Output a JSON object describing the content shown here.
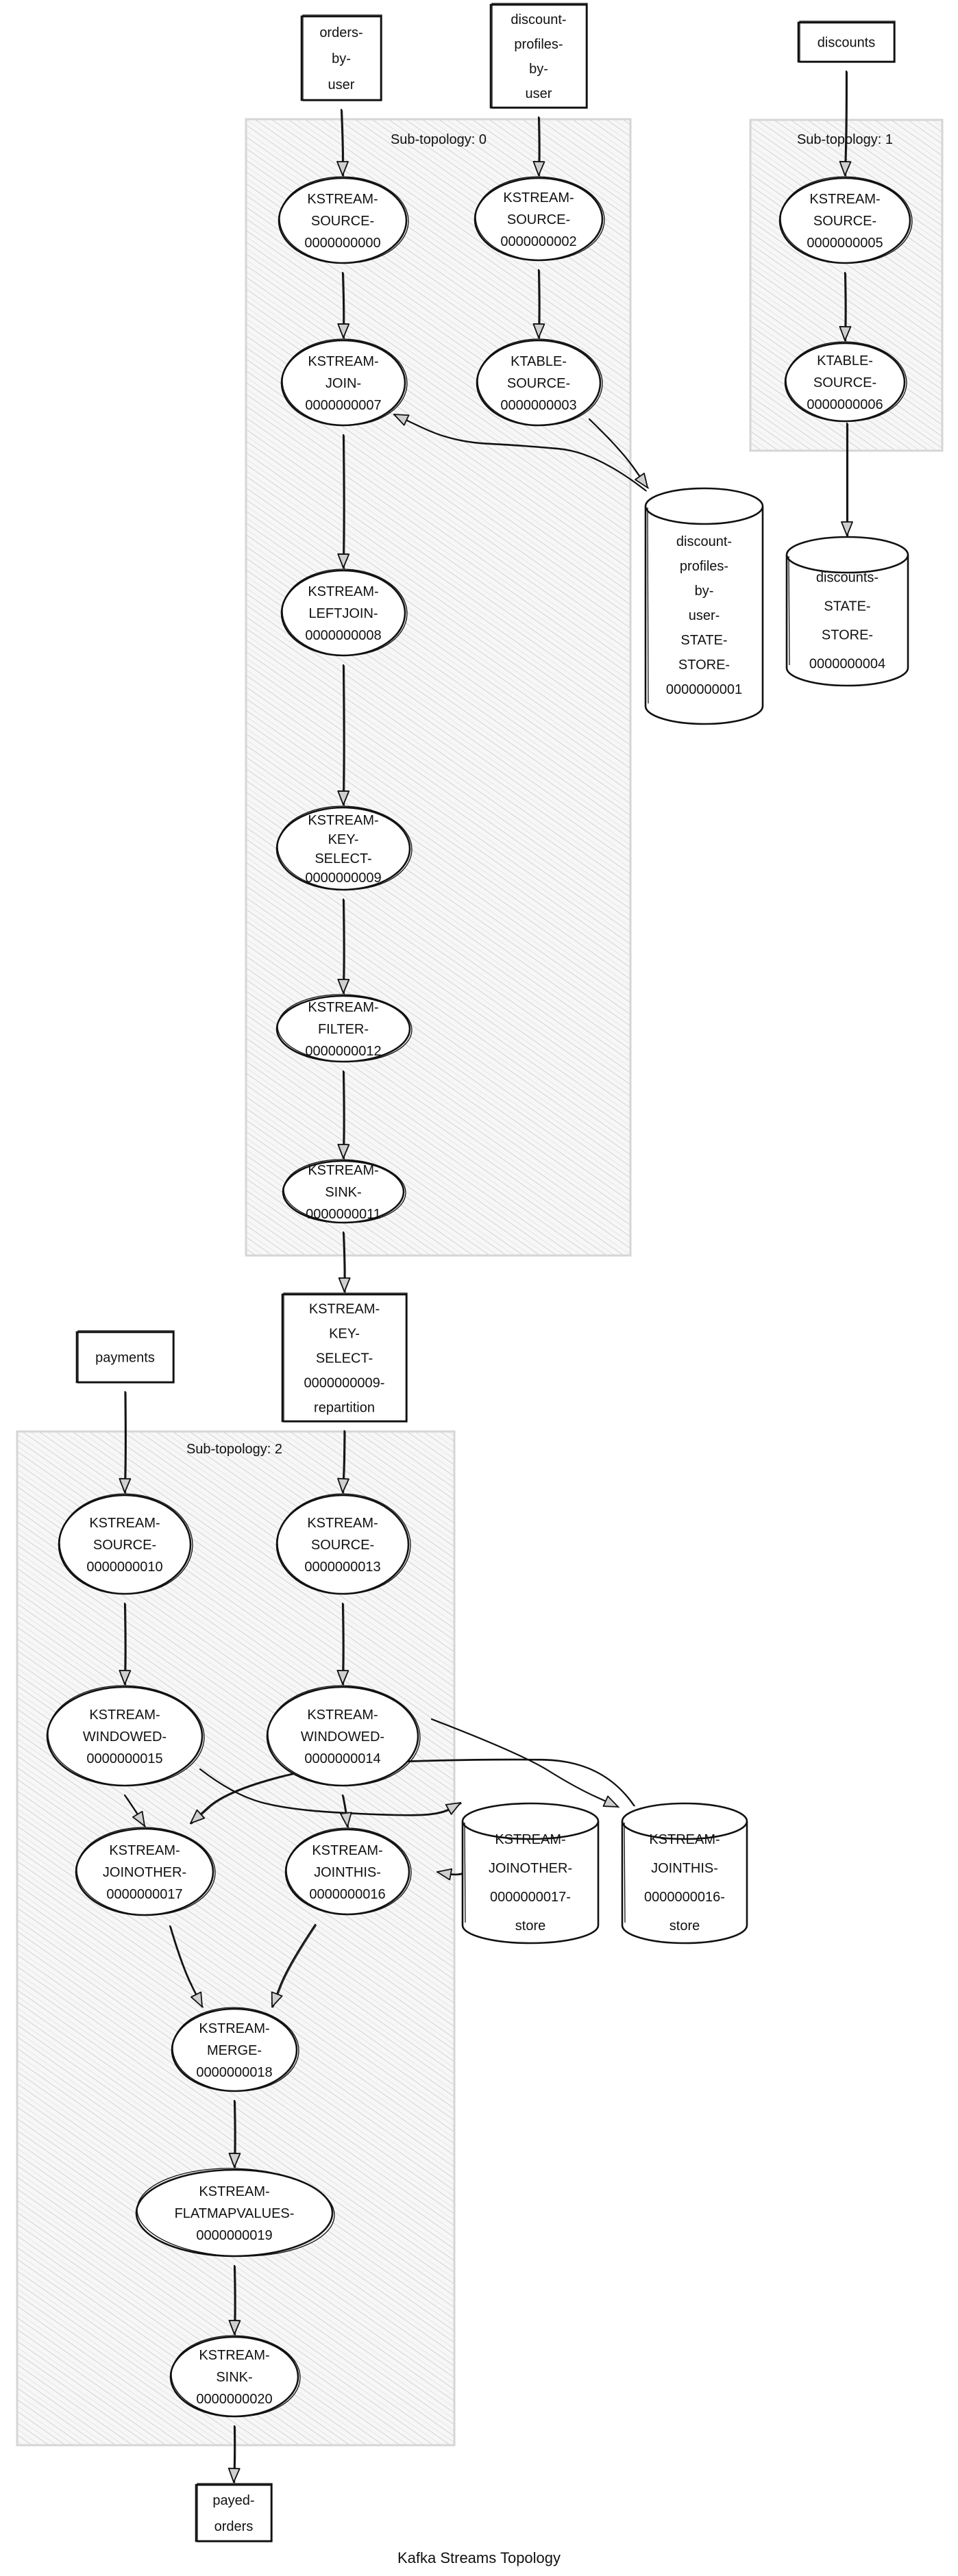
{
  "title": "Kafka Streams Topology",
  "clusters": [
    {
      "id": "sub0",
      "label": "Sub-topology: 0"
    },
    {
      "id": "sub1",
      "label": "Sub-topology: 1"
    },
    {
      "id": "sub2",
      "label": "Sub-topology: 2"
    }
  ],
  "topics": [
    {
      "id": "orders-by-user",
      "lines": [
        "orders-",
        "by-",
        "user"
      ]
    },
    {
      "id": "discount-profiles-by-user",
      "lines": [
        "discount-",
        "profiles-",
        "by-",
        "user"
      ]
    },
    {
      "id": "discounts",
      "lines": [
        "discounts"
      ]
    },
    {
      "id": "repartition",
      "lines": [
        "KSTREAM-",
        "KEY-",
        "SELECT-",
        "0000000009-",
        "repartition"
      ]
    },
    {
      "id": "payments",
      "lines": [
        "payments"
      ]
    },
    {
      "id": "payed-orders",
      "lines": [
        "payed-",
        "orders"
      ]
    }
  ],
  "processors": [
    {
      "id": "src0",
      "cluster": "sub0",
      "lines": [
        "KSTREAM-",
        "SOURCE-",
        "0000000000"
      ]
    },
    {
      "id": "src2",
      "cluster": "sub0",
      "lines": [
        "KSTREAM-",
        "SOURCE-",
        "0000000002"
      ]
    },
    {
      "id": "join7",
      "cluster": "sub0",
      "lines": [
        "KSTREAM-",
        "JOIN-",
        "0000000007"
      ]
    },
    {
      "id": "ktable3",
      "cluster": "sub0",
      "lines": [
        "KTABLE-",
        "SOURCE-",
        "0000000003"
      ]
    },
    {
      "id": "leftjoin8",
      "cluster": "sub0",
      "lines": [
        "KSTREAM-",
        "LEFTJOIN-",
        "0000000008"
      ]
    },
    {
      "id": "keyselect9",
      "cluster": "sub0",
      "lines": [
        "KSTREAM-",
        "KEY-",
        "SELECT-",
        "0000000009"
      ]
    },
    {
      "id": "filter12",
      "cluster": "sub0",
      "lines": [
        "KSTREAM-",
        "FILTER-",
        "0000000012"
      ]
    },
    {
      "id": "sink11",
      "cluster": "sub0",
      "lines": [
        "KSTREAM-",
        "SINK-",
        "0000000011"
      ]
    },
    {
      "id": "src5",
      "cluster": "sub1",
      "lines": [
        "KSTREAM-",
        "SOURCE-",
        "0000000005"
      ]
    },
    {
      "id": "ktable6",
      "cluster": "sub1",
      "lines": [
        "KTABLE-",
        "SOURCE-",
        "0000000006"
      ]
    },
    {
      "id": "src10",
      "cluster": "sub2",
      "lines": [
        "KSTREAM-",
        "SOURCE-",
        "0000000010"
      ]
    },
    {
      "id": "src13",
      "cluster": "sub2",
      "lines": [
        "KSTREAM-",
        "SOURCE-",
        "0000000013"
      ]
    },
    {
      "id": "win15",
      "cluster": "sub2",
      "lines": [
        "KSTREAM-",
        "WINDOWED-",
        "0000000015"
      ]
    },
    {
      "id": "win14",
      "cluster": "sub2",
      "lines": [
        "KSTREAM-",
        "WINDOWED-",
        "0000000014"
      ]
    },
    {
      "id": "joinother17",
      "cluster": "sub2",
      "lines": [
        "KSTREAM-",
        "JOINOTHER-",
        "0000000017"
      ]
    },
    {
      "id": "jointhis16",
      "cluster": "sub2",
      "lines": [
        "KSTREAM-",
        "JOINTHIS-",
        "0000000016"
      ]
    },
    {
      "id": "merge18",
      "cluster": "sub2",
      "lines": [
        "KSTREAM-",
        "MERGE-",
        "0000000018"
      ]
    },
    {
      "id": "flatmap19",
      "cluster": "sub2",
      "lines": [
        "KSTREAM-",
        "FLATMAPVALUES-",
        "0000000019"
      ]
    },
    {
      "id": "sink20",
      "cluster": "sub2",
      "lines": [
        "KSTREAM-",
        "SINK-",
        "0000000020"
      ]
    }
  ],
  "stores": [
    {
      "id": "store1",
      "lines": [
        "discount-",
        "profiles-",
        "by-",
        "user-",
        "STATE-",
        "STORE-",
        "0000000001"
      ]
    },
    {
      "id": "store4",
      "lines": [
        "discounts-",
        "STATE-",
        "STORE-",
        "0000000004"
      ]
    },
    {
      "id": "store17",
      "lines": [
        "KSTREAM-",
        "JOINOTHER-",
        "0000000017-",
        "store"
      ]
    },
    {
      "id": "store16",
      "lines": [
        "KSTREAM-",
        "JOINTHIS-",
        "0000000016-",
        "store"
      ]
    }
  ],
  "edges": [
    {
      "from": "orders-by-user",
      "to": "src0"
    },
    {
      "from": "discount-profiles-by-user",
      "to": "src2"
    },
    {
      "from": "src0",
      "to": "join7"
    },
    {
      "from": "src2",
      "to": "ktable3"
    },
    {
      "from": "ktable3",
      "to": "store1"
    },
    {
      "from": "store1",
      "to": "join7"
    },
    {
      "from": "join7",
      "to": "leftjoin8"
    },
    {
      "from": "leftjoin8",
      "to": "keyselect9"
    },
    {
      "from": "keyselect9",
      "to": "filter12"
    },
    {
      "from": "filter12",
      "to": "sink11"
    },
    {
      "from": "sink11",
      "to": "repartition"
    },
    {
      "from": "discounts",
      "to": "src5"
    },
    {
      "from": "src5",
      "to": "ktable6"
    },
    {
      "from": "ktable6",
      "to": "store4"
    },
    {
      "from": "repartition",
      "to": "src13"
    },
    {
      "from": "payments",
      "to": "src10"
    },
    {
      "from": "src10",
      "to": "win15"
    },
    {
      "from": "src13",
      "to": "win14"
    },
    {
      "from": "win15",
      "to": "joinother17"
    },
    {
      "from": "win15",
      "to": "store17"
    },
    {
      "from": "win14",
      "to": "jointhis16"
    },
    {
      "from": "win14",
      "to": "store16"
    },
    {
      "from": "store16",
      "to": "joinother17"
    },
    {
      "from": "store17",
      "to": "jointhis16"
    },
    {
      "from": "joinother17",
      "to": "merge18"
    },
    {
      "from": "jointhis16",
      "to": "merge18"
    },
    {
      "from": "merge18",
      "to": "flatmap19"
    },
    {
      "from": "flatmap19",
      "to": "sink20"
    },
    {
      "from": "sink20",
      "to": "payed-orders"
    }
  ]
}
